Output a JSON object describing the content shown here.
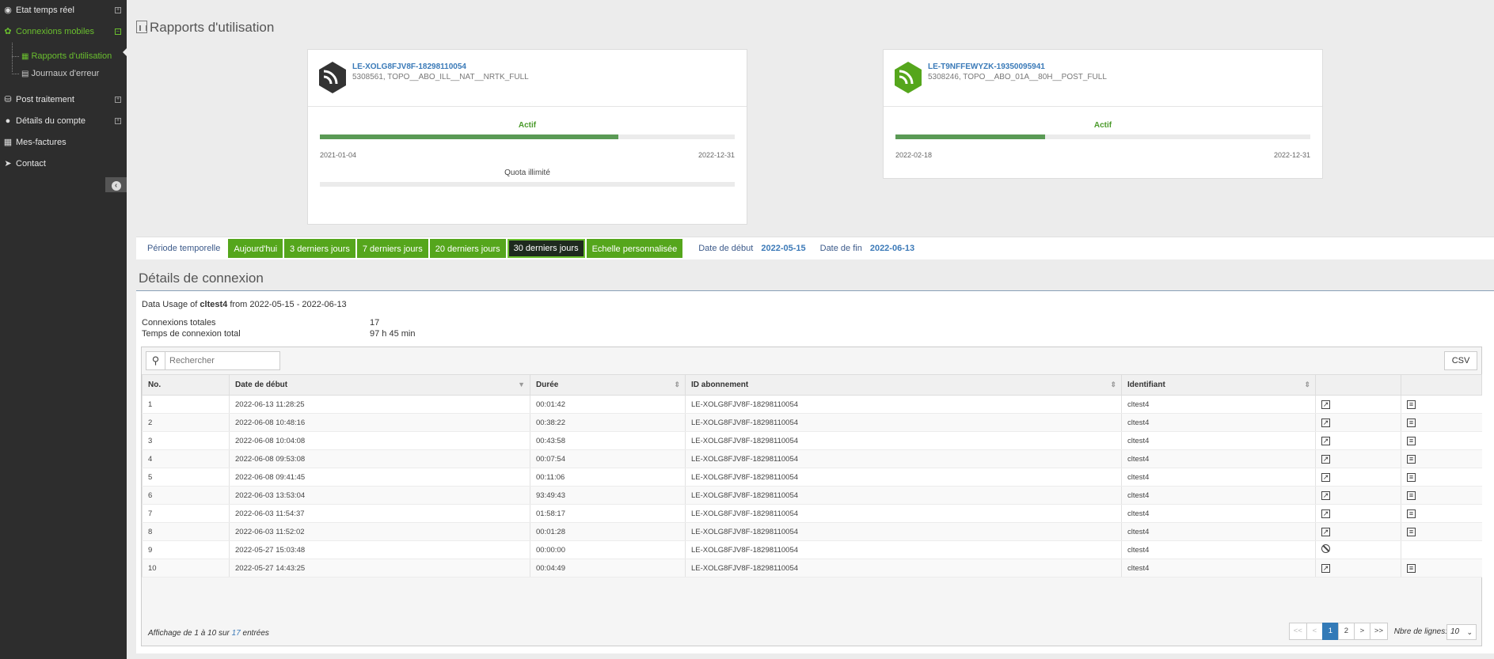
{
  "sidebar": {
    "items": [
      {
        "label": "Etat temps réel",
        "icon": "location-pin-icon"
      },
      {
        "label": "Connexions mobiles",
        "icon": "network-icon"
      },
      {
        "label": "Post traitement",
        "icon": "database-icon"
      },
      {
        "label": "Détails du compte",
        "icon": "user-icon"
      },
      {
        "label": "Mes-factures",
        "icon": "calculator-icon"
      },
      {
        "label": "Contact",
        "icon": "send-icon"
      }
    ],
    "subitems": [
      {
        "label": "Rapports d'utilisation",
        "icon": "chart-icon"
      },
      {
        "label": "Journaux d'erreur",
        "icon": "log-icon"
      }
    ]
  },
  "page": {
    "title": "Rapports d'utilisation"
  },
  "cards": [
    {
      "name": "LE-XOLG8FJV8F-18298110054",
      "sub": "5308561, TOPO__ABO_ILL__NAT__NRTK_FULL",
      "status": "Actif",
      "progress": 0.72,
      "start": "2021-01-04",
      "end": "2022-12-31",
      "quota": "Quota illimité",
      "logo_color": "#333333"
    },
    {
      "name": "LE-T9NFFEWYZK-19350095941",
      "sub": "5308246, TOPO__ABO_01A__80H__POST_FULL",
      "status": "Actif",
      "progress": 0.36,
      "start": "2022-02-18",
      "end": "2022-12-31",
      "logo_color": "#55a61c"
    }
  ],
  "filters": {
    "label": "Période temporelle",
    "buttons": [
      "Aujourd'hui",
      "3 derniers jours",
      "7 derniers jours",
      "20 derniers jours",
      "30 derniers jours",
      "Echelle personnalisée"
    ],
    "selected": "30 derniers jours",
    "start_label": "Date de début",
    "start_value": "2022-05-15",
    "end_label": "Date de fin",
    "end_value": "2022-06-13"
  },
  "details": {
    "title": "Détails de connexion",
    "usage_prefix": "Data Usage of",
    "usage_user": "cltest4",
    "usage_suffix": "from 2022-05-15 - 2022-06-13",
    "total_label": "Connexions totales",
    "total_value": "17",
    "time_label": "Temps de connexion total",
    "time_value": "97 h 45 min"
  },
  "table": {
    "search_placeholder": "Rechercher",
    "csv_label": "CSV",
    "columns": [
      "No.",
      "Date de début",
      "Durée",
      "ID abonnement",
      "Identifiant",
      "",
      ""
    ],
    "rows": [
      [
        "1",
        "2022-06-13 11:28:25",
        "00:01:42",
        "LE-XOLG8FJV8F-18298110054",
        "cltest4",
        "open",
        "report"
      ],
      [
        "2",
        "2022-06-08 10:48:16",
        "00:38:22",
        "LE-XOLG8FJV8F-18298110054",
        "cltest4",
        "open",
        "report"
      ],
      [
        "3",
        "2022-06-08 10:04:08",
        "00:43:58",
        "LE-XOLG8FJV8F-18298110054",
        "cltest4",
        "open",
        "report"
      ],
      [
        "4",
        "2022-06-08 09:53:08",
        "00:07:54",
        "LE-XOLG8FJV8F-18298110054",
        "cltest4",
        "open",
        "report"
      ],
      [
        "5",
        "2022-06-08 09:41:45",
        "00:11:06",
        "LE-XOLG8FJV8F-18298110054",
        "cltest4",
        "open",
        "report"
      ],
      [
        "6",
        "2022-06-03 13:53:04",
        "93:49:43",
        "LE-XOLG8FJV8F-18298110054",
        "cltest4",
        "open",
        "report"
      ],
      [
        "7",
        "2022-06-03 11:54:37",
        "01:58:17",
        "LE-XOLG8FJV8F-18298110054",
        "cltest4",
        "open",
        "report"
      ],
      [
        "8",
        "2022-06-03 11:52:02",
        "00:01:28",
        "LE-XOLG8FJV8F-18298110054",
        "cltest4",
        "open",
        "report"
      ],
      [
        "9",
        "2022-05-27 15:03:48",
        "00:00:00",
        "LE-XOLG8FJV8F-18298110054",
        "cltest4",
        "ban",
        ""
      ],
      [
        "10",
        "2022-05-27 14:43:25",
        "00:04:49",
        "LE-XOLG8FJV8F-18298110054",
        "cltest4",
        "open",
        "report"
      ]
    ],
    "info_prefix": "Affichage de 1 à 10 sur",
    "info_total": "17",
    "info_suffix": "entrées",
    "pages": [
      "<<",
      "<",
      "1",
      "2",
      ">",
      ">>"
    ],
    "current_page": "1",
    "rows_label": "Nbre de lignes:",
    "rows_value": "10"
  }
}
